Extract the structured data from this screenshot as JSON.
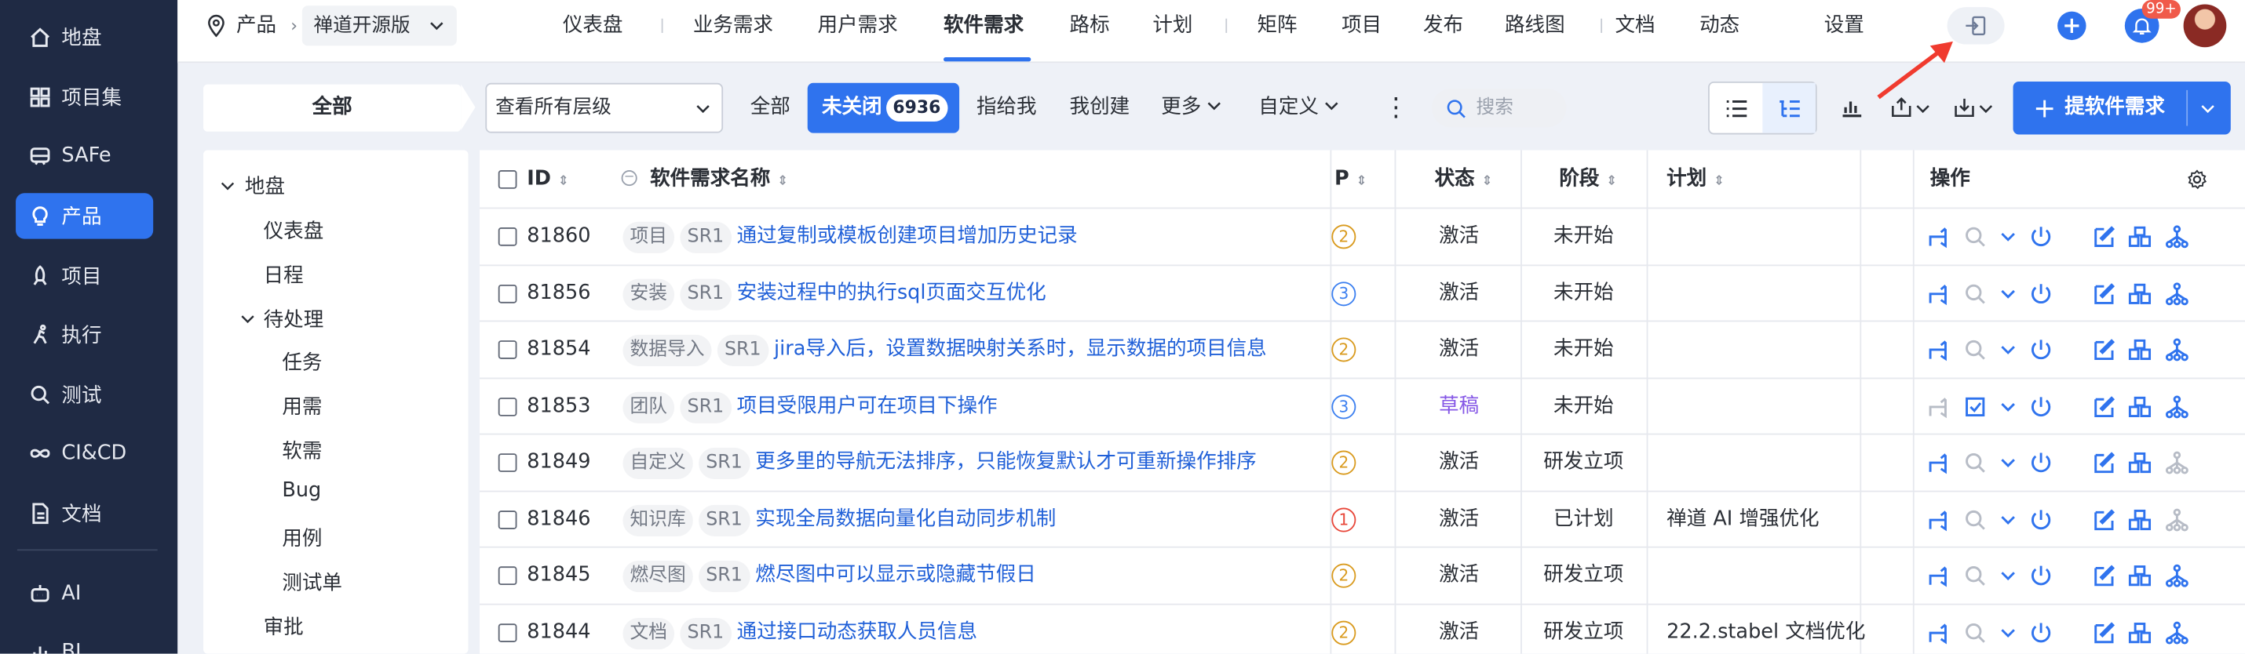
{
  "colors": {
    "sidebar_bg": "#1f2a44",
    "accent": "#2f73ee",
    "p1": "#e8473a",
    "p2": "#d99a1d",
    "p3": "#3b7ff0",
    "draft": "#8557e6"
  },
  "sidebar": {
    "items": [
      {
        "label": "地盘",
        "icon": "home-icon"
      },
      {
        "label": "项目集",
        "icon": "grid-icon"
      },
      {
        "label": "SAFe",
        "icon": "train-icon"
      },
      {
        "label": "产品",
        "icon": "bulb-icon",
        "active": true
      },
      {
        "label": "项目",
        "icon": "rocket-icon"
      },
      {
        "label": "执行",
        "icon": "run-icon"
      },
      {
        "label": "测试",
        "icon": "magnifier-icon"
      },
      {
        "label": "CI&CD",
        "icon": "infinity-icon"
      },
      {
        "label": "文档",
        "icon": "document-icon"
      },
      {
        "label": "AI",
        "icon": "robot-icon"
      },
      {
        "label": "BI",
        "icon": "bi-icon"
      }
    ]
  },
  "topbar": {
    "breadcrumb_root": "产品",
    "product_name": "禅道开源版",
    "nav": [
      "仪表盘",
      "业务需求",
      "用户需求",
      "软件需求",
      "路标",
      "计划",
      "矩阵",
      "项目",
      "发布",
      "路线图",
      "文档",
      "动态",
      "设置"
    ],
    "active_nav": "软件需求",
    "notif_count": "99+"
  },
  "filters": {
    "tree_tab": "全部",
    "level_select": "查看所有层级",
    "all": "全部",
    "unclosed": "未关闭",
    "unclosed_count": "6936",
    "assigned_to_me": "指给我",
    "created_by_me": "我创建",
    "more": "更多",
    "custom": "自定义",
    "search_placeholder": "搜索",
    "add_button": "提软件需求"
  },
  "tree": {
    "root": "地盘",
    "children": [
      "仪表盘",
      "日程"
    ],
    "pending": "待处理",
    "pending_children": [
      "任务",
      "用需",
      "软需",
      "Bug",
      "用例",
      "测试单"
    ],
    "approval": "审批"
  },
  "table": {
    "headers": {
      "id": "ID",
      "name": "软件需求名称",
      "pri": "P",
      "status": "状态",
      "stage": "阶段",
      "plan": "计划",
      "actions": "操作"
    },
    "rows": [
      {
        "id": "81860",
        "tag": "项目",
        "sr": "SR1",
        "title": "通过复制或模板创建项目增加历史记录",
        "pri": "2",
        "status": "激活",
        "stage": "未开始",
        "plan": "",
        "draft": false,
        "open": false
      },
      {
        "id": "81856",
        "tag": "安装",
        "sr": "SR1",
        "title": "安装过程中的执行sql页面交互优化",
        "pri": "3",
        "status": "激活",
        "stage": "未开始",
        "plan": "",
        "draft": false,
        "open": false
      },
      {
        "id": "81854",
        "tag": "数据导入",
        "sr": "SR1",
        "title": "jira导入后，设置数据映射关系时，显示数据的项目信息",
        "pri": "2",
        "status": "激活",
        "stage": "未开始",
        "plan": "",
        "draft": false,
        "open": false
      },
      {
        "id": "81853",
        "tag": "团队",
        "sr": "SR1",
        "title": "项目受限用户可在项目下操作",
        "pri": "3",
        "status": "草稿",
        "stage": "未开始",
        "plan": "",
        "draft": true,
        "open": false
      },
      {
        "id": "81849",
        "tag": "自定义",
        "sr": "SR1",
        "title": "更多里的导航无法排序，只能恢复默认才可重新操作排序",
        "pri": "2",
        "status": "激活",
        "stage": "研发立项",
        "plan": "",
        "draft": false,
        "open": true
      },
      {
        "id": "81846",
        "tag": "知识库",
        "sr": "SR1",
        "title": "实现全局数据向量化自动同步机制",
        "pri": "1",
        "status": "激活",
        "stage": "已计划",
        "plan": "禅道 AI 增强优化",
        "draft": false,
        "open": true
      },
      {
        "id": "81845",
        "tag": "燃尽图",
        "sr": "SR1",
        "title": "燃尽图中可以显示或隐藏节假日",
        "pri": "2",
        "status": "激活",
        "stage": "研发立项",
        "plan": "",
        "draft": false,
        "open": false
      },
      {
        "id": "81844",
        "tag": "文档",
        "sr": "SR1",
        "title": "通过接口动态获取人员信息",
        "pri": "2",
        "status": "激活",
        "stage": "研发立项",
        "plan": "22.2.stabel 文档优化",
        "draft": false,
        "open": false
      }
    ]
  }
}
